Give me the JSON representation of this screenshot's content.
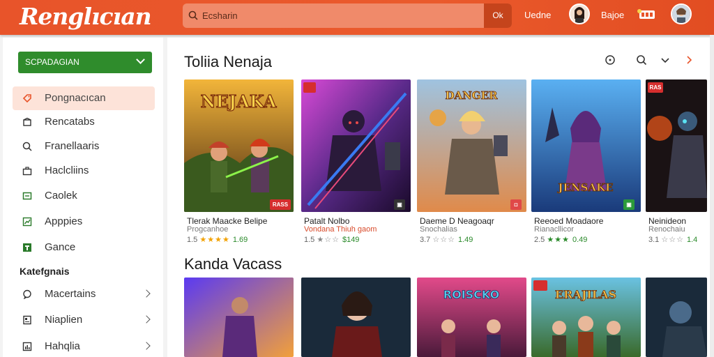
{
  "header": {
    "logo": "Renglıcıan",
    "search_placeholder": "Ecsharin",
    "search_button": "Ok",
    "links": [
      "Uedne",
      "Bajoe"
    ]
  },
  "sidebar": {
    "dropdown_label": "SCPADAGIAN",
    "items": [
      {
        "label": "Pongnacıcan",
        "icon": "tag-icon",
        "active": true
      },
      {
        "label": "Rencatabs",
        "icon": "box-icon"
      },
      {
        "label": "Franellaaris",
        "icon": "search-icon"
      },
      {
        "label": "Haclcliins",
        "icon": "briefcase-icon"
      },
      {
        "label": "Caolek",
        "icon": "card-icon"
      },
      {
        "label": "Apppies",
        "icon": "chart-icon"
      },
      {
        "label": "Gance",
        "icon": "game-icon"
      }
    ],
    "categories_title": "Katefgnais",
    "categories": [
      {
        "label": "Macertains",
        "icon": "chat-icon"
      },
      {
        "label": "Niaplien",
        "icon": "doc-icon"
      },
      {
        "label": "Hahqlia",
        "icon": "bar-chart-icon"
      }
    ]
  },
  "sections": [
    {
      "title": "Toliia Nenaja",
      "cards": [
        {
          "title": "Tlerak Maacke Belipe",
          "subtitle": "Progcanhoe",
          "rating": "1.5",
          "stars": "★★★★",
          "price": "1.69",
          "sub_red": false,
          "badge": "RASS",
          "badge_color": "#d62e2e",
          "art_text": "NEJAKA"
        },
        {
          "title": "Patalt Nolbo",
          "subtitle": "Vondana Thiuh gaom",
          "rating": "1.5",
          "stars": "★☆☆",
          "price": "$149",
          "sub_red": true,
          "badge": "▣",
          "badge_color": "#333333",
          "art_text": ""
        },
        {
          "title": "Daeme D Neagoaqr",
          "subtitle": "Snochalias",
          "rating": "3.7",
          "stars": "☆☆☆",
          "price": "1.49",
          "sub_red": false,
          "badge": "◘",
          "badge_color": "#e04848",
          "art_text": "DANGER"
        },
        {
          "title": "Reeoed Moadaore",
          "subtitle": "Rianacllicor",
          "rating": "2.5",
          "stars": "★★★",
          "price": "0.49",
          "sub_red": false,
          "badge": "▣",
          "badge_color": "#2b9a3a",
          "art_text": "JENSAKE"
        },
        {
          "title": "Neinideon",
          "subtitle": "Renochaiu",
          "rating": "3.1",
          "stars": "☆☆☆",
          "price": "1.4",
          "sub_red": false,
          "badge": "RAS",
          "badge_color": "#d62e2e",
          "art_text": ""
        }
      ]
    },
    {
      "title": "Kanda Vacass",
      "cards": [
        {
          "art_text": ""
        },
        {
          "art_text": ""
        },
        {
          "art_text": "ROISCKO"
        },
        {
          "art_text": "ERAJILAS"
        },
        {
          "art_text": ""
        }
      ]
    }
  ],
  "colors": {
    "header": "#e8542a",
    "accent_green": "#2f8c2c",
    "active_bg": "#fde3d9",
    "star": "#f2a100"
  }
}
